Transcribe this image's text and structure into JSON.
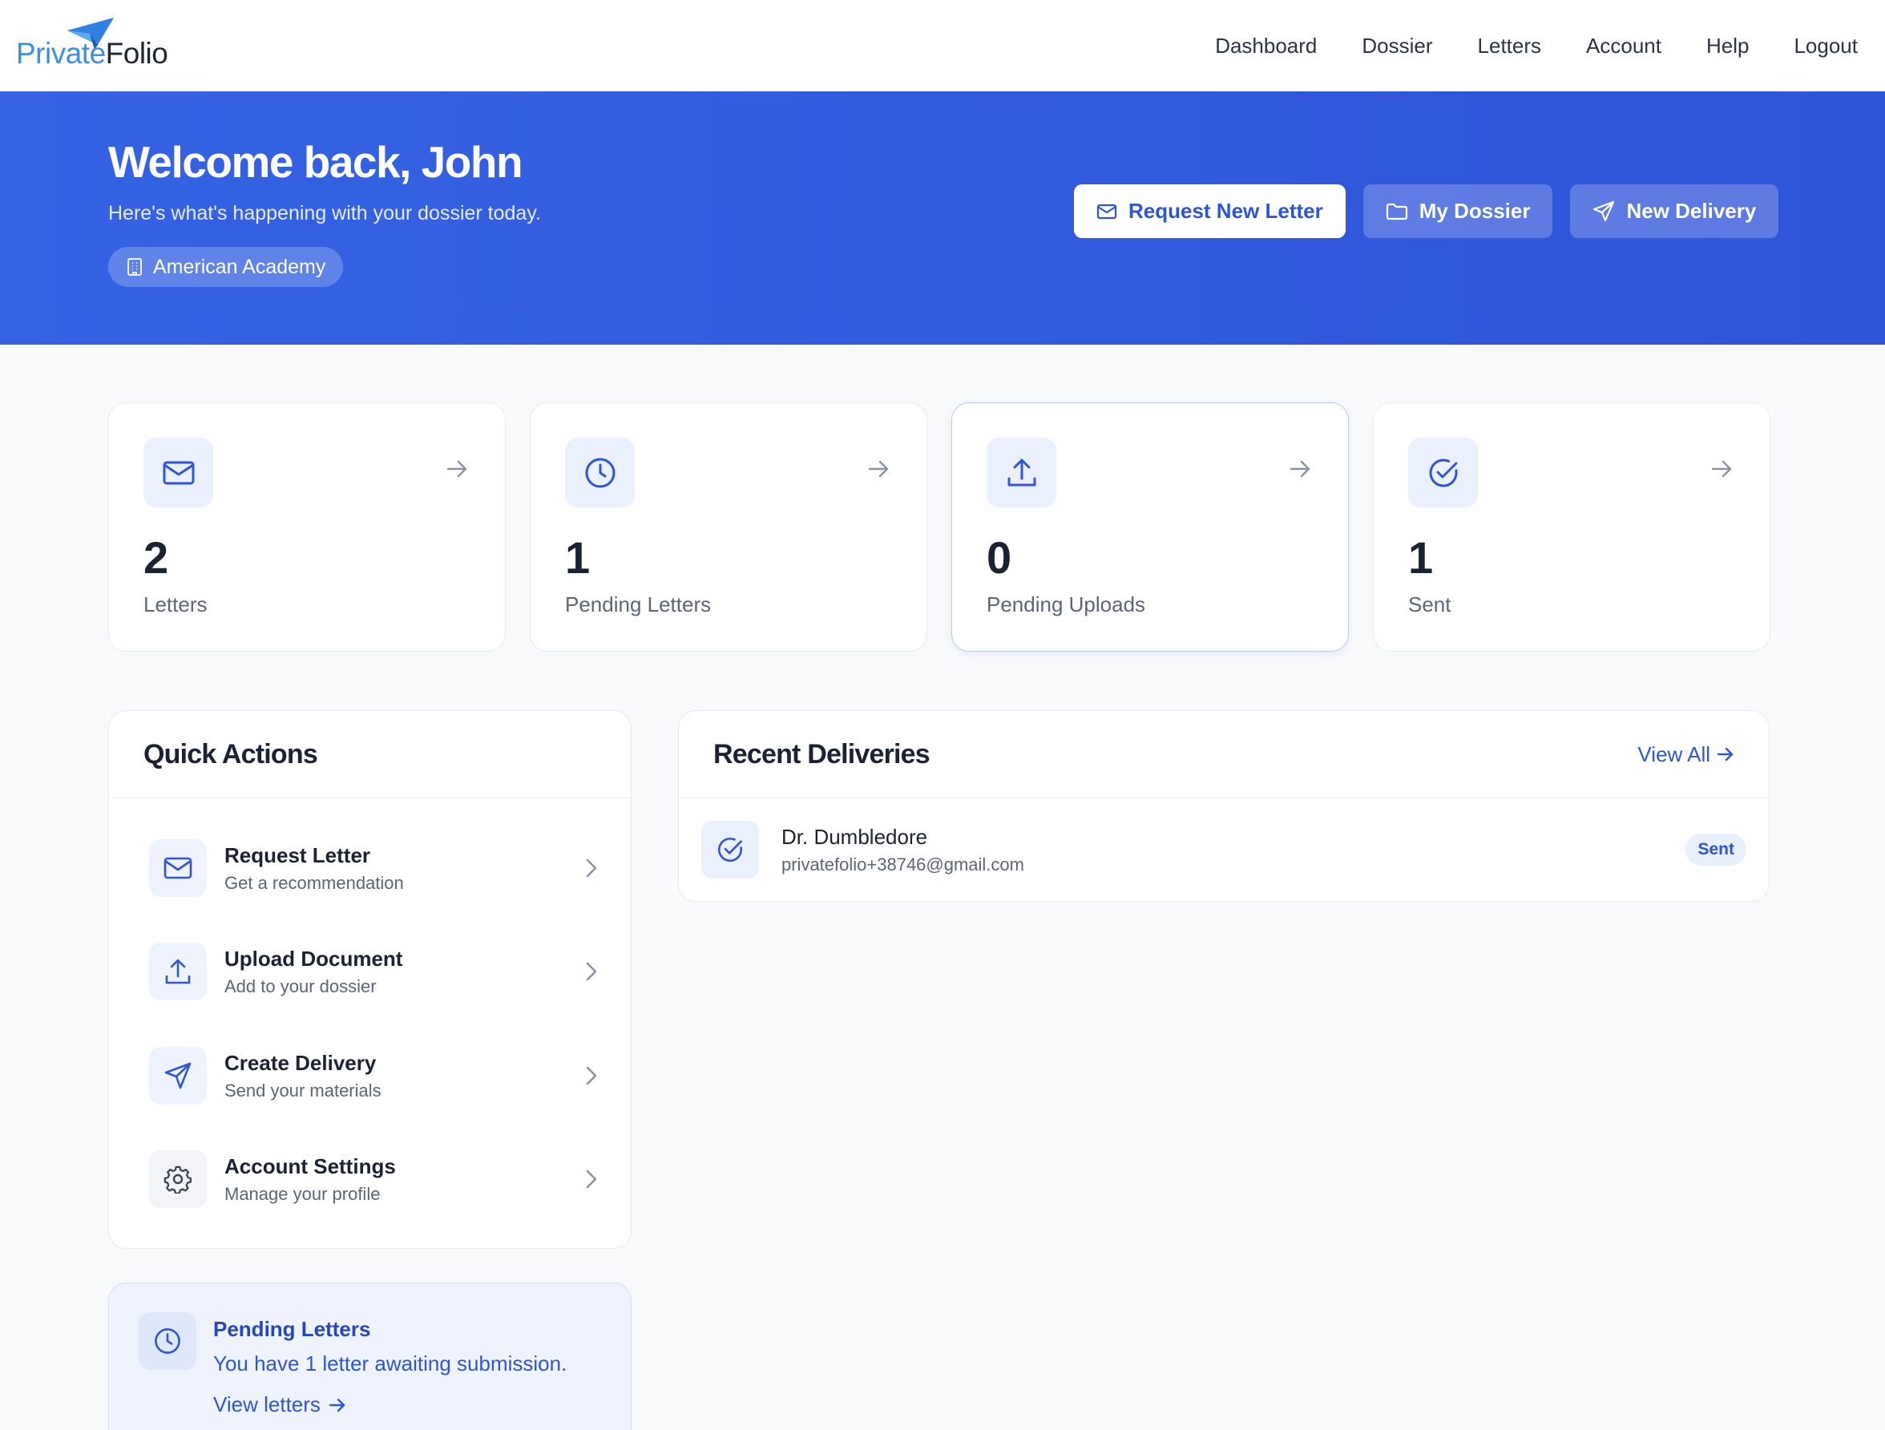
{
  "brand": {
    "name_part1": "Private",
    "name_part2": "Folio",
    "accent": "#3c8fe6"
  },
  "nav": {
    "items": [
      "Dashboard",
      "Dossier",
      "Letters",
      "Account",
      "Help",
      "Logout"
    ]
  },
  "hero": {
    "title": "Welcome back, John",
    "subtitle": "Here's what's happening with your dossier today.",
    "institution": "American Academy",
    "buttons": {
      "request": "Request New Letter",
      "dossier": "My Dossier",
      "delivery": "New Delivery"
    },
    "bg_color": "#3563e4"
  },
  "stats": [
    {
      "value": "2",
      "label": "Letters",
      "icon": "mail-icon"
    },
    {
      "value": "1",
      "label": "Pending Letters",
      "icon": "clock-icon"
    },
    {
      "value": "0",
      "label": "Pending Uploads",
      "icon": "upload-icon"
    },
    {
      "value": "1",
      "label": "Sent",
      "icon": "check-circle-icon"
    }
  ],
  "quick_actions": {
    "title": "Quick Actions",
    "items": [
      {
        "title": "Request Letter",
        "subtitle": "Get a recommendation",
        "icon": "mail-icon"
      },
      {
        "title": "Upload Document",
        "subtitle": "Add to your dossier",
        "icon": "upload-icon"
      },
      {
        "title": "Create Delivery",
        "subtitle": "Send your materials",
        "icon": "send-icon"
      },
      {
        "title": "Account Settings",
        "subtitle": "Manage your profile",
        "icon": "gear-icon"
      }
    ]
  },
  "recent_deliveries": {
    "title": "Recent Deliveries",
    "view_all": "View All",
    "rows": [
      {
        "name": "Dr. Dumbledore",
        "email": "privatefolio+38746@gmail.com",
        "status": "Sent"
      }
    ]
  },
  "pending_notice": {
    "title": "Pending Letters",
    "message": "You have 1 letter awaiting submission.",
    "link": "View letters"
  }
}
